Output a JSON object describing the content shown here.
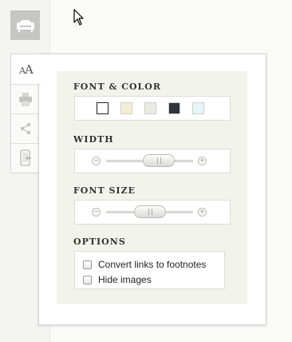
{
  "sidebar": {
    "app_icon": "armchair-icon",
    "tabs": [
      {
        "icon": "text-size-icon",
        "label_large": "A",
        "label_small": "A"
      },
      {
        "icon": "printer-icon"
      },
      {
        "icon": "share-icon"
      },
      {
        "icon": "send-to-device-icon"
      }
    ]
  },
  "popup": {
    "font_color": {
      "title": "FONT & COLOR",
      "swatches": [
        {
          "color": "#ffffff",
          "selected": true
        },
        {
          "color": "#f5eed5",
          "selected": false
        },
        {
          "color": "#ebebe6",
          "selected": false
        },
        {
          "color": "#32353b",
          "selected": false
        },
        {
          "color": "#e6f5fa",
          "selected": false
        }
      ]
    },
    "width": {
      "title": "WIDTH",
      "value_fraction": 0.67
    },
    "font_size": {
      "title": "FONT SIZE",
      "value_fraction": 0.5
    },
    "options": {
      "title": "OPTIONS",
      "items": [
        {
          "label": "Convert links to footnotes",
          "checked": false
        },
        {
          "label": "Hide images",
          "checked": false
        }
      ]
    }
  }
}
